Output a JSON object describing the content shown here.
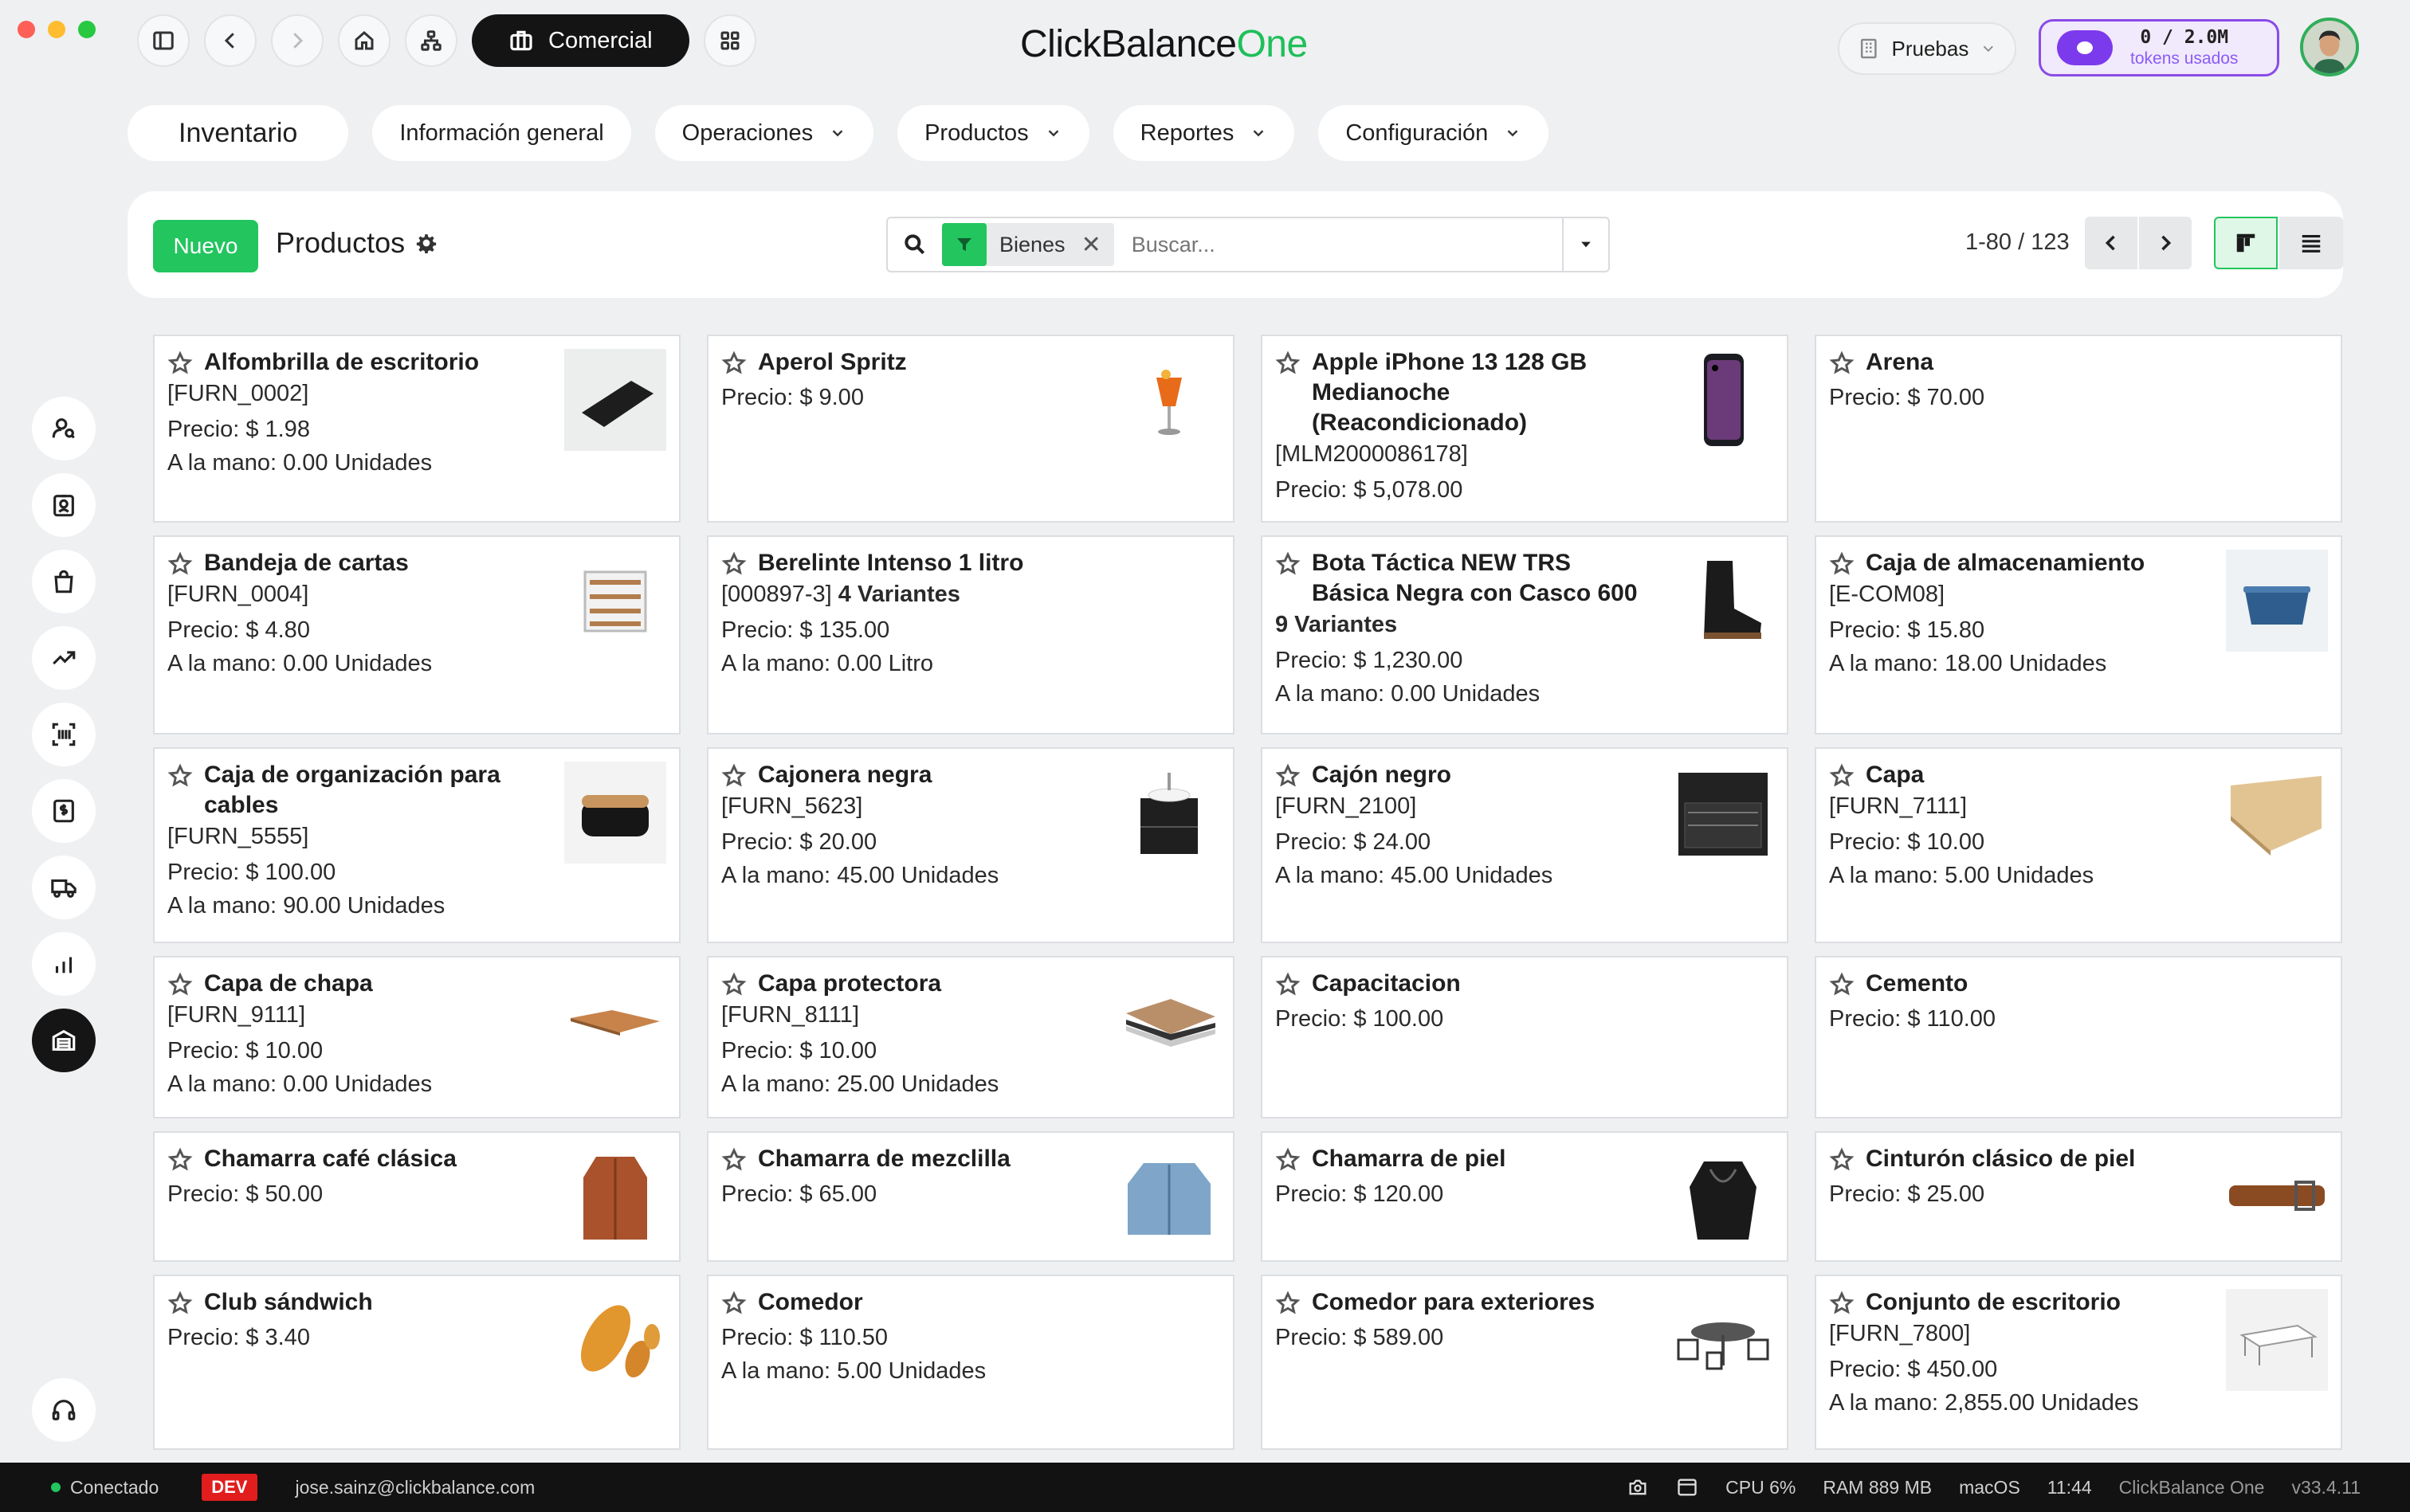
{
  "brand": {
    "part1": "ClickBalance",
    "part2": "One"
  },
  "topbar": {
    "app_label": "Comercial"
  },
  "env": {
    "label": "Pruebas"
  },
  "tokens": {
    "count": "0 / 2.0M",
    "label": "tokens usados"
  },
  "menu": [
    {
      "label": "Inventario"
    },
    {
      "label": "Información general"
    },
    {
      "label": "Operaciones"
    },
    {
      "label": "Productos"
    },
    {
      "label": "Reportes"
    },
    {
      "label": "Configuración"
    }
  ],
  "control": {
    "new_label": "Nuevo",
    "title": "Productos",
    "facet_label": "Bienes",
    "search_placeholder": "Buscar...",
    "pager": "1-80 / 123"
  },
  "products": [
    {
      "name": "Alfombrilla de escritorio",
      "code": "[FURN_0002]",
      "variants": "",
      "price": "Precio: $ 1.98",
      "stock": "A la mano: 0.00 Unidades",
      "icon": "mousepad"
    },
    {
      "name": "Aperol Spritz",
      "code": "",
      "variants": "",
      "price": "Precio: $ 9.00",
      "stock": "",
      "icon": "cocktail"
    },
    {
      "name": "Apple iPhone 13 128 GB Medianoche (Reacondicionado)",
      "code": "[MLM2000086178]",
      "variants": "",
      "price": "Precio: $ 5,078.00",
      "stock": "",
      "icon": "phone"
    },
    {
      "name": "Arena",
      "code": "",
      "variants": "",
      "price": "Precio: $ 70.00",
      "stock": "",
      "icon": ""
    },
    {
      "name": "Bandeja de cartas",
      "code": "[FURN_0004]",
      "variants": "",
      "price": "Precio: $ 4.80",
      "stock": "A la mano: 0.00 Unidades",
      "icon": "tray"
    },
    {
      "name": "Berelinte Intenso 1 litro",
      "code": "[000897-3]",
      "variants": "4 Variantes",
      "price": "Precio: $ 135.00",
      "stock": "A la mano: 0.00 Litro",
      "icon": ""
    },
    {
      "name": "Bota Táctica NEW TRS Básica Negra con Casco 600",
      "code": "",
      "variants": "9 Variantes",
      "price": "Precio: $ 1,230.00",
      "stock": "A la mano: 0.00 Unidades",
      "icon": "boot"
    },
    {
      "name": "Caja de almacenamiento",
      "code": "[E-COM08]",
      "variants": "",
      "price": "Precio: $ 15.80",
      "stock": "A la mano: 18.00 Unidades",
      "icon": "bin"
    },
    {
      "name": "Caja de organización para cables",
      "code": "[FURN_5555]",
      "variants": "",
      "price": "Precio: $ 100.00",
      "stock": "A la mano: 90.00 Unidades",
      "icon": "cablebox"
    },
    {
      "name": "Cajonera negra",
      "code": "[FURN_5623]",
      "variants": "",
      "price": "Precio: $ 20.00",
      "stock": "A la mano: 45.00 Unidades",
      "icon": "vanity"
    },
    {
      "name": "Cajón negro",
      "code": "[FURN_2100]",
      "variants": "",
      "price": "Precio: $ 24.00",
      "stock": "A la mano: 45.00 Unidades",
      "icon": "drawer"
    },
    {
      "name": "Capa",
      "code": "[FURN_7111]",
      "variants": "",
      "price": "Precio: $ 10.00",
      "stock": "A la mano: 5.00 Unidades",
      "icon": "plywood"
    },
    {
      "name": "Capa de chapa",
      "code": "[FURN_9111]",
      "variants": "",
      "price": "Precio: $ 10.00",
      "stock": "A la mano: 0.00 Unidades",
      "icon": "veneer"
    },
    {
      "name": "Capa protectora",
      "code": "[FURN_8111]",
      "variants": "",
      "price": "Precio: $ 10.00",
      "stock": "A la mano: 25.00 Unidades",
      "icon": "layers"
    },
    {
      "name": "Capacitacion",
      "code": "",
      "variants": "",
      "price": "Precio: $ 100.00",
      "stock": "",
      "icon": ""
    },
    {
      "name": "Cemento",
      "code": "",
      "variants": "",
      "price": "Precio: $ 110.00",
      "stock": "",
      "icon": ""
    },
    {
      "name": "Chamarra café clásica",
      "code": "",
      "variants": "",
      "price": "Precio: $ 50.00",
      "stock": "",
      "icon": "jacket-brown"
    },
    {
      "name": "Chamarra de mezclilla",
      "code": "",
      "variants": "",
      "price": "Precio: $ 65.00",
      "stock": "",
      "icon": "jacket-denim"
    },
    {
      "name": "Chamarra de piel",
      "code": "",
      "variants": "",
      "price": "Precio: $ 120.00",
      "stock": "",
      "icon": "jacket-leather"
    },
    {
      "name": "Cinturón clásico de piel",
      "code": "",
      "variants": "",
      "price": "Precio: $ 25.00",
      "stock": "",
      "icon": "belt"
    },
    {
      "name": "Club sándwich",
      "code": "",
      "variants": "",
      "price": "Precio: $ 3.40",
      "stock": "",
      "icon": "bread"
    },
    {
      "name": "Comedor",
      "code": "",
      "variants": "",
      "price": "Precio: $ 110.50",
      "stock": "A la mano: 5.00 Unidades",
      "icon": ""
    },
    {
      "name": "Comedor para exteriores",
      "code": "",
      "variants": "",
      "price": "Precio: $ 589.00",
      "stock": "",
      "icon": "patio"
    },
    {
      "name": "Conjunto de escritorio",
      "code": "[FURN_7800]",
      "variants": "",
      "price": "Precio: $ 450.00",
      "stock": "A la mano: 2,855.00 Unidades",
      "icon": "desk"
    }
  ],
  "statusbar": {
    "connection": "Conectado",
    "env_badge": "DEV",
    "email": "jose.sainz@clickbalance.com",
    "cpu": "CPU 6%",
    "ram": "RAM 889 MB",
    "os": "macOS",
    "time": "11:44",
    "app": "ClickBalance One",
    "version": "v33.4.11"
  }
}
